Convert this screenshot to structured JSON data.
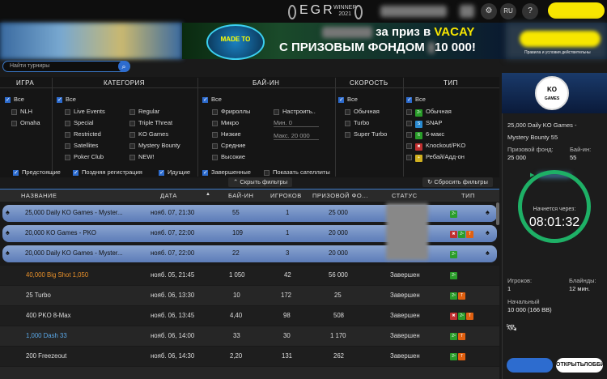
{
  "header": {
    "logo_text": "EGR",
    "logo_sub1": "WINNER",
    "logo_sub2": "2021",
    "lang": "RU",
    "help": "?"
  },
  "banner": {
    "made_text": "MADE TO",
    "line1_prefix": "за приз в ",
    "line1_brand": "VACAY",
    "line2": "С ПРИЗОВЫМ ФОНДОМ ",
    "line2_suffix": "10 000!",
    "small": "Правила и условия действительны"
  },
  "search": {
    "placeholder": "Найти турниры"
  },
  "filters": {
    "headers": {
      "game": "ИГРА",
      "category": "КАТЕГОРИЯ",
      "buyin": "БАЙ-ИН",
      "speed": "СКОРОСТЬ",
      "type": "ТИП"
    },
    "game": [
      "Все",
      "NLH",
      "Omaha"
    ],
    "category_col1": [
      "Все",
      "Live Events",
      "Special",
      "Restricted",
      "Satellites",
      "Poker Club"
    ],
    "category_col2": [
      "Regular",
      "Triple Threat",
      "KO Games",
      "Mystery Bounty",
      "NEW!"
    ],
    "buyin": [
      "Все",
      "Фрироллы",
      "Микро",
      "Низкие",
      "Средние",
      "Высокие"
    ],
    "buyin_custom": "Настроить..",
    "min_label": "Мин. 0",
    "max_label": "Макс. 20 000",
    "speed": [
      "Все",
      "Обычная",
      "Turbo",
      "Super Turbo"
    ],
    "type": [
      "Все",
      "Обычная",
      "SNAP",
      "6-макс",
      "Knockout/PKO",
      "Ребай/Адд-он"
    ],
    "bottom": [
      "Предстоящие",
      "Поздняя регистрация",
      "Идущие",
      "Завершенные",
      "Показать сателлиты"
    ],
    "hide": "Скрыть фильтры",
    "reset": "Сбросить фильтры"
  },
  "table": {
    "headers": {
      "name": "НАЗВАНИЕ",
      "date": "ДАТА",
      "buyin": "БАЙ-ИН",
      "players": "ИГРОКОВ",
      "prize": "ПРИЗОВОЙ ФО...",
      "status": "СТАТУС",
      "type": "ТИП"
    },
    "rows": [
      {
        "name": "25,000 Daily KO Games - Myster...",
        "date": "нояб. 07, 21:30",
        "buyin": "55",
        "players": "1",
        "prize": "25 000",
        "status": ""
      },
      {
        "name": "20,000 KO Games - PKO",
        "date": "нояб. 07, 22:00",
        "buyin": "109",
        "players": "1",
        "prize": "20 000",
        "status": ""
      },
      {
        "name": "20,000 Daily KO Games - Myster...",
        "date": "нояб. 07, 22:00",
        "buyin": "22",
        "players": "3",
        "prize": "20 000",
        "status": ""
      },
      {
        "name": "40,000 Big Shot 1,050",
        "date": "нояб. 05, 21:45",
        "buyin": "1 050",
        "players": "42",
        "prize": "56 000",
        "status": "Завершен"
      },
      {
        "name": "25 Turbo",
        "date": "нояб. 06, 13:30",
        "buyin": "10",
        "players": "172",
        "prize": "25",
        "status": "Завершен"
      },
      {
        "name": "400 PKO 8-Max",
        "date": "нояб. 06, 13:45",
        "buyin": "4,40",
        "players": "98",
        "prize": "508",
        "status": "Завершен"
      },
      {
        "name": "1,000 Dash 33",
        "date": "нояб. 06, 14:00",
        "buyin": "33",
        "players": "30",
        "prize": "1 170",
        "status": "Завершен"
      },
      {
        "name": "200 Freezeout",
        "date": "нояб. 06, 14:30",
        "buyin": "2,20",
        "players": "131",
        "prize": "262",
        "status": "Завершен"
      }
    ]
  },
  "details": {
    "title1": "25,000 Daily KO Games -",
    "title2": "Mystery Bounty 55",
    "prize_label": "Призовой фонд:",
    "prize_value": "25 000",
    "buyin_label": "Бай-ин:",
    "buyin_value": "55",
    "starts_label": "Начнется через:",
    "timer": "08:01:32",
    "players_label": "Игроков:",
    "players_value": "1",
    "blinds_label": "Блайнды:",
    "blinds_value": "12 мин.",
    "stack_label": "Начальный",
    "stack_value": "10 000 (166 BB)",
    "lobby_button": "ОТКРЫТЬЛОББИ"
  },
  "colors": {
    "accent": "#2d6ccf",
    "yellow": "#f7e600",
    "ring": "#1eb066"
  }
}
